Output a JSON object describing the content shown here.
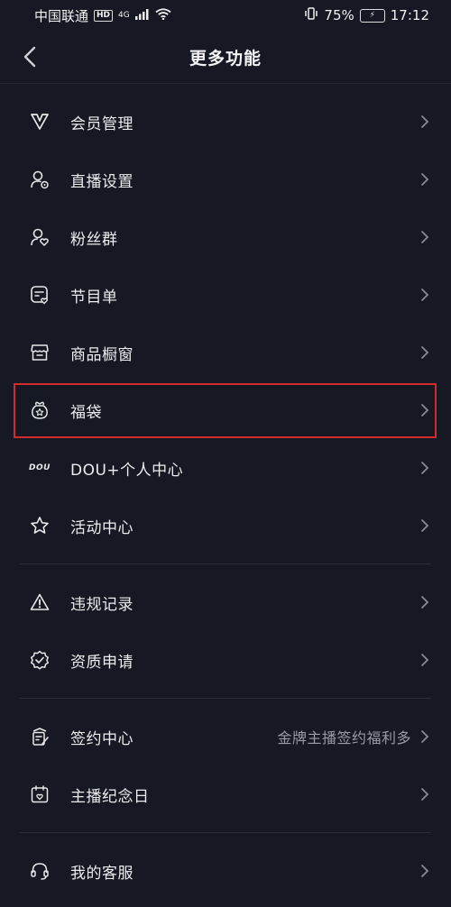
{
  "status_bar": {
    "carrier": "中国联通",
    "network_badge": "HD",
    "signal_label": "4G",
    "battery": "75%",
    "time": "17:12"
  },
  "header": {
    "title": "更多功能",
    "back_icon": "chevron-left-icon"
  },
  "groups": [
    {
      "items": [
        {
          "label": "会员管理",
          "icon": "vip-v-icon"
        },
        {
          "label": "直播设置",
          "icon": "user-settings-icon"
        },
        {
          "label": "粉丝群",
          "icon": "fan-group-icon"
        },
        {
          "label": "节目单",
          "icon": "program-list-icon"
        },
        {
          "label": "商品橱窗",
          "icon": "shop-window-icon"
        },
        {
          "label": "福袋",
          "icon": "lucky-bag-icon",
          "highlighted": true
        },
        {
          "label": "DOU+个人中心",
          "icon": "dou-plus-icon",
          "icon_text": "DOU"
        },
        {
          "label": "活动中心",
          "icon": "star-icon"
        }
      ]
    },
    {
      "items": [
        {
          "label": "违规记录",
          "icon": "warning-icon"
        },
        {
          "label": "资质申请",
          "icon": "verified-badge-icon"
        }
      ]
    },
    {
      "items": [
        {
          "label": "签约中心",
          "icon": "contract-icon",
          "note": "金牌主播签约福利多"
        },
        {
          "label": "主播纪念日",
          "icon": "calendar-icon"
        }
      ]
    },
    {
      "items": [
        {
          "label": "我的客服",
          "icon": "headset-icon"
        }
      ]
    }
  ],
  "colors": {
    "background": "#161823",
    "highlight_border": "#d02c2c"
  }
}
